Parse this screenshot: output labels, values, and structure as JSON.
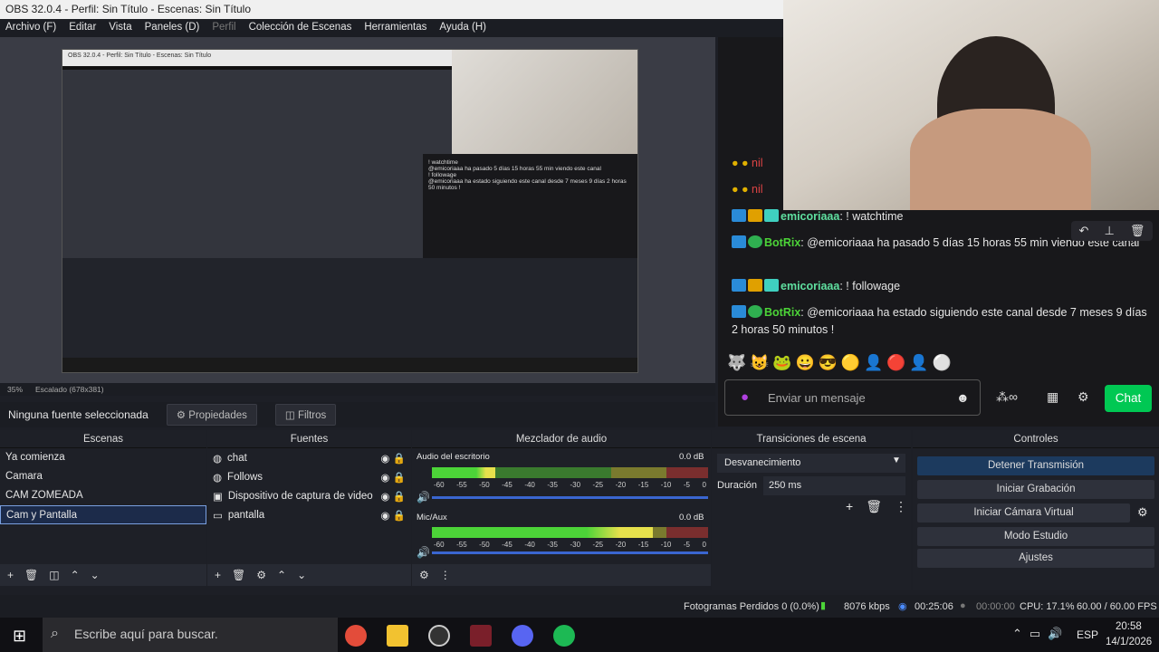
{
  "window": {
    "title": "OBS 32.0.4 - Perfil: Sin Título - Escenas: Sin Título"
  },
  "menu": {
    "items": [
      "Archivo (F)",
      "Editar",
      "Vista",
      "Paneles (D)",
      "Perfil",
      "Colección de Escenas",
      "Herramientas",
      "Ayuda (H)"
    ]
  },
  "preview": {
    "zoom": "35%",
    "scale": "Escalado (678x381)",
    "mini_title": "OBS 32.0.4 - Perfil: Sin Título - Escenas: Sin Título"
  },
  "source_toolbar": {
    "none_selected": "Ninguna fuente seleccionada",
    "properties": "Propiedades",
    "filters": "Filtros"
  },
  "chat": {
    "messages": [
      {
        "user": "emicoriaaa",
        "text": "! watchtime",
        "color": "#5fe0a0"
      },
      {
        "user": "BotRix",
        "text": "@emicoriaaa ha pasado 5 días 15 horas 55 min viendo este canal",
        "color": "#4cd438"
      },
      {
        "user": "emicoriaaa",
        "text": "! followage",
        "color": "#5fe0a0"
      },
      {
        "user": "BotRix",
        "text": "@emicoriaaa ha estado siguiendo este canal desde 7 meses 9 días 2 horas 50 minutos !",
        "color": "#4cd438"
      }
    ],
    "input_placeholder": "Enviar un mensaje",
    "send_label": "Chat",
    "partial_user": "nil"
  },
  "scenes": {
    "title": "Escenas",
    "items": [
      "Ya comienza",
      "Camara",
      "CAM ZOMEADA",
      "Cam y Pantalla"
    ],
    "selected": 3
  },
  "sources": {
    "title": "Fuentes",
    "items": [
      {
        "name": "chat",
        "icon": "browser-icon"
      },
      {
        "name": "Follows",
        "icon": "browser-icon"
      },
      {
        "name": "Dispositivo de captura de video",
        "icon": "camera-icon"
      },
      {
        "name": "pantalla",
        "icon": "monitor-icon"
      }
    ]
  },
  "mixer": {
    "title": "Mezclador de audio",
    "channels": [
      {
        "name": "Audio del escritorio",
        "db": "0.0 dB",
        "level": 0.23
      },
      {
        "name": "Mic/Aux",
        "db": "0.0 dB",
        "level": 0.8
      }
    ],
    "scale": [
      "-60",
      "-55",
      "-50",
      "-45",
      "-40",
      "-35",
      "-30",
      "-25",
      "-20",
      "-15",
      "-10",
      "-5",
      "0"
    ]
  },
  "transitions": {
    "title": "Transiciones de escena",
    "type": "Desvanecimiento",
    "duration_label": "Duración",
    "duration": "250 ms"
  },
  "controls": {
    "title": "Controles",
    "buttons": [
      "Detener Transmisión",
      "Iniciar Grabación",
      "Iniciar Cámara Virtual",
      "Modo Estudio",
      "Ajustes"
    ]
  },
  "status": {
    "dropped": "Fotogramas Perdidos 0 (0.0%)",
    "bitrate": "8076 kbps",
    "live_time": "00:25:06",
    "rec_time": "00:00:00",
    "cpu": "CPU: 17.1%",
    "fps": "60.00 / 60.00 FPS"
  },
  "taskbar": {
    "search": "Escribe aquí para buscar.",
    "lang": "ESP",
    "time": "20:58",
    "date": "14/1/2026"
  },
  "colors": {
    "accent": "#00c853",
    "selected_border": "#7aa0e0"
  }
}
